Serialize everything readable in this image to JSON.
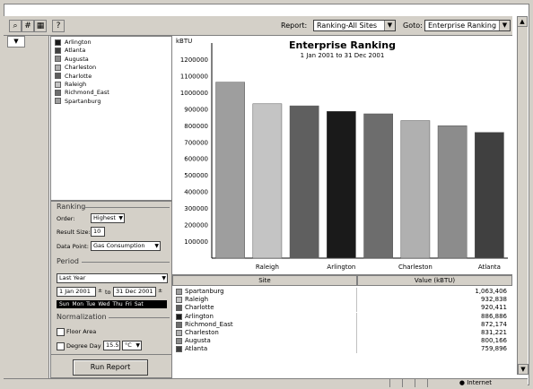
{
  "toolbar": {
    "report_label": "Report:",
    "report_value": "Ranking-All Sites",
    "goto_label": "Goto:",
    "goto_value": "Enterprise Ranking",
    "icons": [
      "zoom-icon",
      "grid-icon",
      "calendar-icon",
      "help-icon"
    ]
  },
  "legend": {
    "items": [
      {
        "label": "Arlington",
        "color": "#1a1a1a"
      },
      {
        "label": "Atlanta",
        "color": "#404040"
      },
      {
        "label": "Augusta",
        "color": "#8c8c8c"
      },
      {
        "label": "Charleston",
        "color": "#b0b0b0"
      },
      {
        "label": "Charlotte",
        "color": "#5f5f5f"
      },
      {
        "label": "Raleigh",
        "color": "#c4c4c4"
      },
      {
        "label": "Richmond_East",
        "color": "#6d6d6d"
      },
      {
        "label": "Spartanburg",
        "color": "#9e9e9e"
      }
    ]
  },
  "ranking": {
    "title": "Ranking",
    "order_label": "Order:",
    "order_value": "Highest",
    "result_size_label": "Result Size:",
    "result_size_value": "10",
    "data_point_label": "Data Point:",
    "data_point_value": "Gas Consumption"
  },
  "period": {
    "title": "Period",
    "preset_value": "Last Year",
    "start_date": "1 Jan 2001",
    "to_label": "to",
    "end_date": "31 Dec 2001",
    "days": [
      "Sun",
      "Mon",
      "Tue",
      "Wed",
      "Thu",
      "Fri",
      "Sat"
    ]
  },
  "normalization": {
    "title": "Normalization",
    "floor_area_label": "Floor Area",
    "degree_day_label": "Degree Day",
    "degree_day_value": "15.5",
    "unit_value": "°C"
  },
  "run_button": "Run Report",
  "chart_data": {
    "type": "bar",
    "title": "Enterprise Ranking",
    "subtitle": "1 Jan 2001 to 31 Dec 2001",
    "ylabel": "kBTU",
    "ylim": [
      0,
      1300000
    ],
    "yticks": [
      100000,
      200000,
      300000,
      400000,
      500000,
      600000,
      700000,
      800000,
      900000,
      1000000,
      1100000,
      1200000
    ],
    "ytick_labels": [
      "100000",
      "200000",
      "300000",
      "400000",
      "500000",
      "600000",
      "700000",
      "800000",
      "900000",
      "1000000",
      "1100000",
      "1200000"
    ],
    "categories": [
      "Spartanburg",
      "Raleigh",
      "Charlotte",
      "Arlington",
      "Richmond_East",
      "Charleston",
      "Augusta",
      "Atlanta"
    ],
    "values": [
      1063406,
      932838,
      920411,
      886886,
      872174,
      831221,
      800166,
      759896
    ],
    "colors": [
      "#9e9e9e",
      "#c4c4c4",
      "#5f5f5f",
      "#1a1a1a",
      "#6d6d6d",
      "#b0b0b0",
      "#8c8c8c",
      "#404040"
    ],
    "shown_xtick_labels": [
      "Raleigh",
      "Arlington",
      "Charleston",
      "Atlanta"
    ]
  },
  "table": {
    "headers": [
      "Site",
      "Value (kBTU)"
    ],
    "rows": [
      {
        "site": "Spartanburg",
        "value": "1,063,406",
        "color": "#9e9e9e"
      },
      {
        "site": "Raleigh",
        "value": "932,838",
        "color": "#c4c4c4"
      },
      {
        "site": "Charlotte",
        "value": "920,411",
        "color": "#5f5f5f"
      },
      {
        "site": "Arlington",
        "value": "886,886",
        "color": "#1a1a1a"
      },
      {
        "site": "Richmond_East",
        "value": "872,174",
        "color": "#6d6d6d"
      },
      {
        "site": "Charleston",
        "value": "831,221",
        "color": "#b0b0b0"
      },
      {
        "site": "Augusta",
        "value": "800,166",
        "color": "#8c8c8c"
      },
      {
        "site": "Atlanta",
        "value": "759,896",
        "color": "#404040"
      }
    ]
  },
  "status": {
    "zone": "Internet"
  }
}
